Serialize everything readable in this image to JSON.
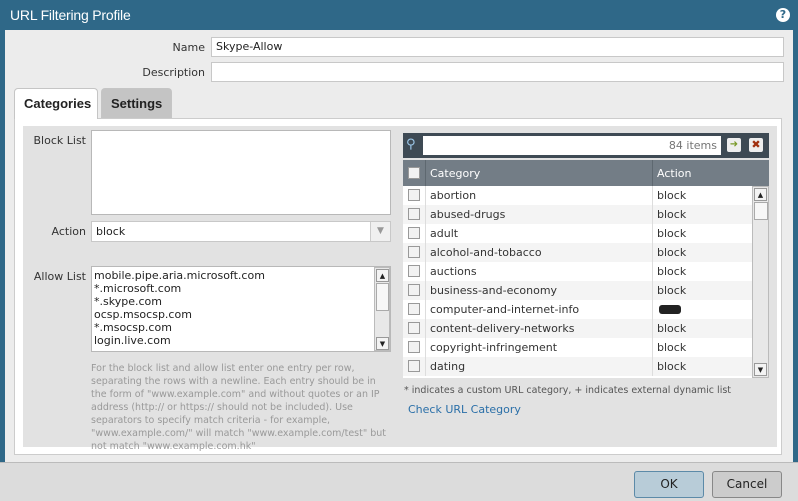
{
  "title": "URL Filtering Profile",
  "help_icon": "?",
  "form": {
    "name_label": "Name",
    "name_value": "Skype-Allow",
    "description_label": "Description",
    "description_value": ""
  },
  "tabs": [
    {
      "label": "Categories",
      "active": true
    },
    {
      "label": "Settings",
      "active": false
    }
  ],
  "block_list": {
    "label": "Block List",
    "value": ""
  },
  "action": {
    "label": "Action",
    "value": "block"
  },
  "allow_list": {
    "label": "Allow List",
    "lines": [
      "mobile.pipe.aria.microsoft.com",
      "*.microsoft.com",
      "*.skype.com",
      "ocsp.msocsp.com",
      "*.msocsp.com",
      "login.live.com"
    ]
  },
  "help_text": "For the block list and allow list enter one entry per row, separating the rows with a newline. Each entry should be in the form of \"www.example.com\" and without quotes or an IP address (http:// or https:// should not be included). Use separators to specify match criteria - for example, \"www.example.com/\" will match \"www.example.com/test\" but not match \"www.example.com.hk\"",
  "table": {
    "search_placeholder": "84 items",
    "columns": [
      "Category",
      "Action"
    ],
    "rows": [
      {
        "category": "abortion",
        "action": "block"
      },
      {
        "category": "abused-drugs",
        "action": "block"
      },
      {
        "category": "adult",
        "action": "block"
      },
      {
        "category": "alcohol-and-tobacco",
        "action": "block"
      },
      {
        "category": "auctions",
        "action": "block"
      },
      {
        "category": "business-and-economy",
        "action": "block"
      },
      {
        "category": "computer-and-internet-info",
        "action": "",
        "redacted": true
      },
      {
        "category": "content-delivery-networks",
        "action": "block"
      },
      {
        "category": "copyright-infringement",
        "action": "block"
      },
      {
        "category": "dating",
        "action": "block"
      }
    ]
  },
  "table_note": "* indicates a custom URL category, + indicates external dynamic list",
  "check_link": "Check URL Category",
  "buttons": {
    "ok": "OK",
    "cancel": "Cancel"
  }
}
